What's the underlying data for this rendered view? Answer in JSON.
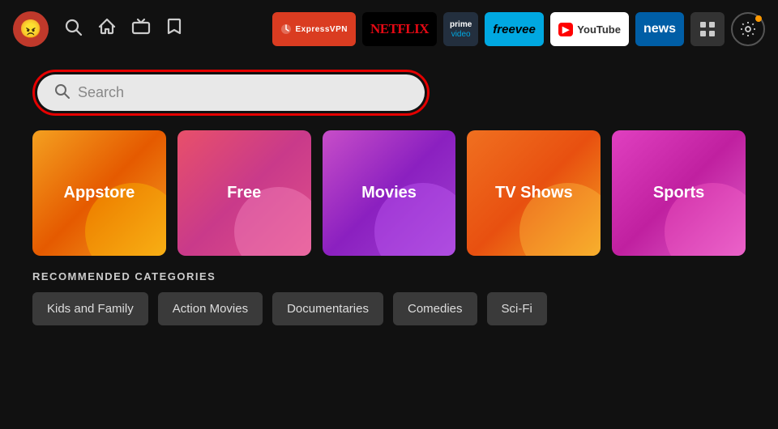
{
  "nav": {
    "avatar_emoji": "😠",
    "icons": {
      "search": "🔍",
      "home": "⌂",
      "tv": "📺",
      "bookmark": "🔖"
    },
    "apps": [
      {
        "name": "expressvpn",
        "label": "ExpressVPN",
        "class": "badge-expressvpn"
      },
      {
        "name": "netflix",
        "label": "NETFLIX",
        "class": "badge-netflix"
      },
      {
        "name": "prime",
        "label": "prime video",
        "class": "badge-prime"
      },
      {
        "name": "freevee",
        "label": "freevee",
        "class": "badge-freevee"
      },
      {
        "name": "youtube",
        "label": "YouTube",
        "class": "badge-youtube"
      },
      {
        "name": "news",
        "label": "news",
        "class": "badge-news"
      }
    ],
    "grid_icon": "⊞",
    "settings_icon": "⚙"
  },
  "search": {
    "placeholder": "Search"
  },
  "categories": [
    {
      "id": "appstore",
      "label": "Appstore",
      "class": "cat-appstore"
    },
    {
      "id": "free",
      "label": "Free",
      "class": "cat-free"
    },
    {
      "id": "movies",
      "label": "Movies",
      "class": "cat-movies"
    },
    {
      "id": "tvshows",
      "label": "TV Shows",
      "class": "cat-tvshows"
    },
    {
      "id": "sports",
      "label": "Sports",
      "class": "cat-sports"
    }
  ],
  "recommended": {
    "title": "RECOMMENDED CATEGORIES",
    "tags": [
      {
        "id": "kids",
        "label": "Kids and Family"
      },
      {
        "id": "action",
        "label": "Action Movies"
      },
      {
        "id": "documentaries",
        "label": "Documentaries"
      },
      {
        "id": "comedies",
        "label": "Comedies"
      },
      {
        "id": "scifi",
        "label": "Sci-Fi"
      }
    ]
  }
}
